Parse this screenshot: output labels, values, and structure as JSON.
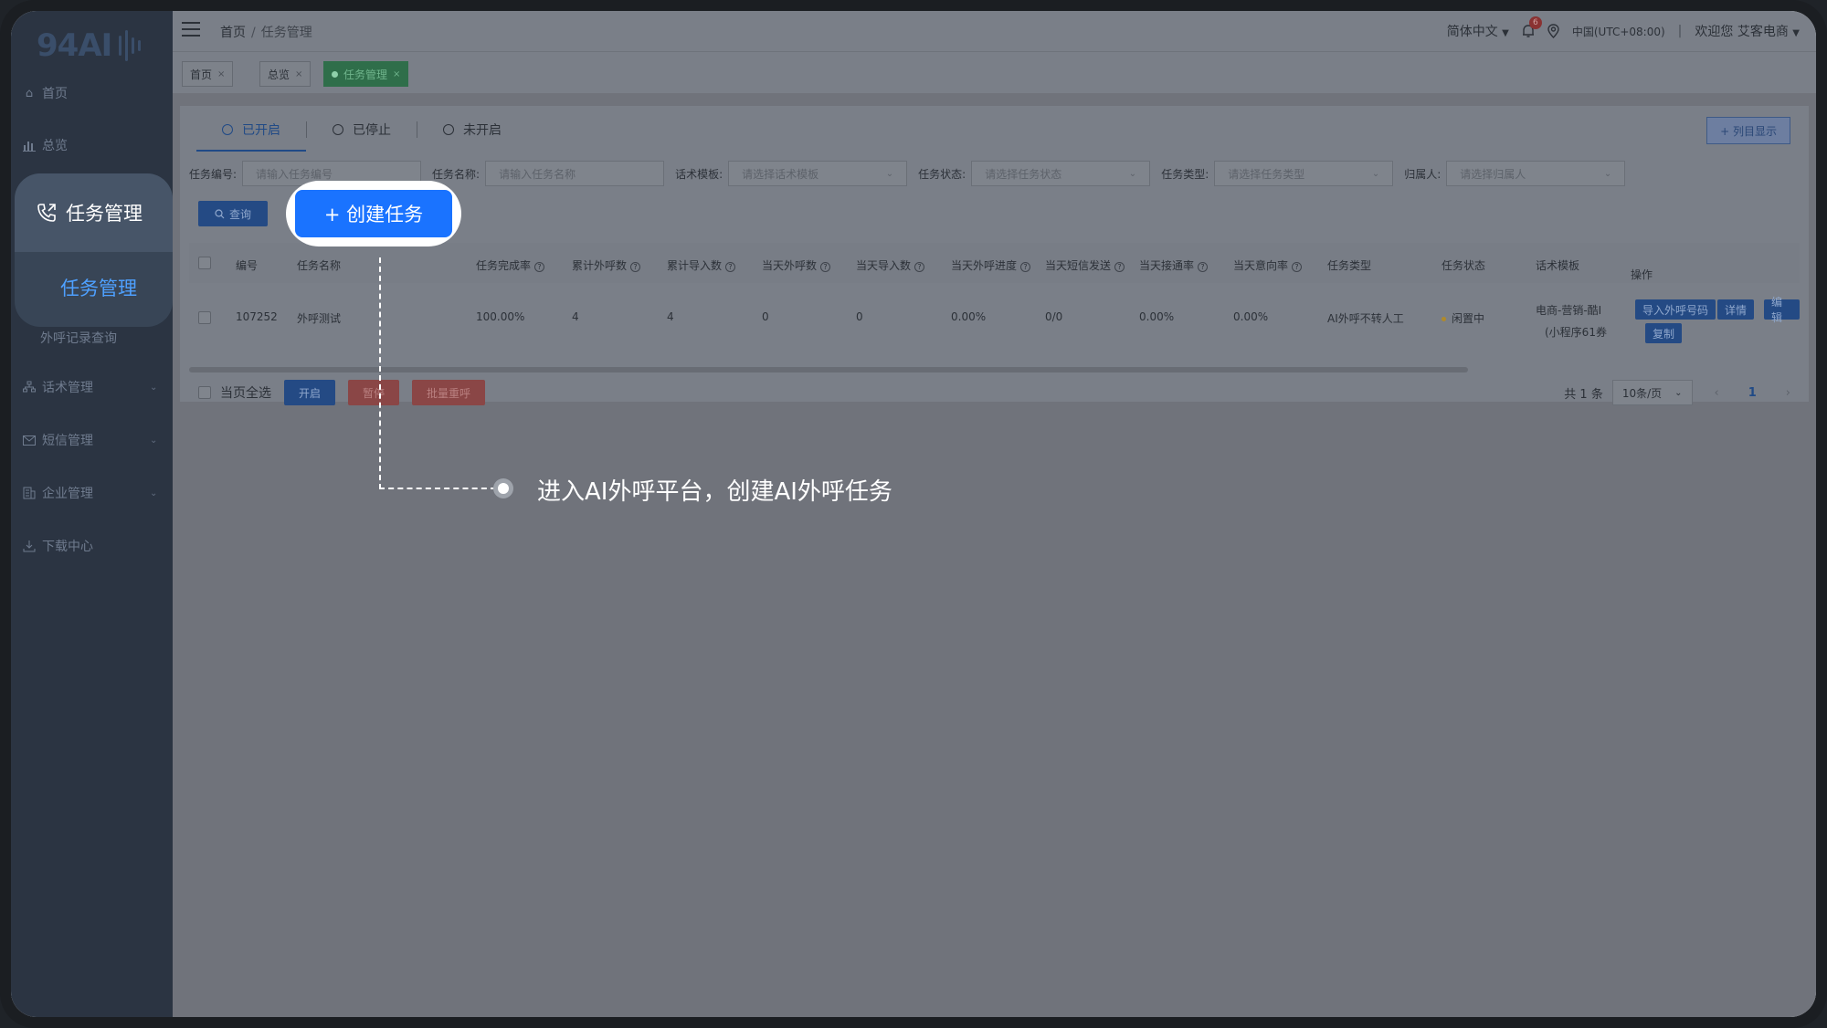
{
  "logo": {
    "text": "94AI"
  },
  "sidebar": {
    "items": [
      {
        "label": "首页",
        "icon": "home-icon"
      },
      {
        "label": "总览",
        "icon": "chart-icon"
      },
      {
        "label": "任务管理",
        "icon": "phone-icon"
      },
      {
        "label": "任务管理",
        "sub": true
      },
      {
        "label": "外呼记录查询",
        "sub": true
      },
      {
        "label": "话术管理",
        "icon": "org-icon",
        "expandable": true
      },
      {
        "label": "短信管理",
        "icon": "mail-icon",
        "expandable": true
      },
      {
        "label": "企业管理",
        "icon": "building-icon",
        "expandable": true
      },
      {
        "label": "下载中心",
        "icon": "download-icon"
      }
    ]
  },
  "header": {
    "breadcrumb": [
      "首页",
      "任务管理"
    ],
    "language": "简体中文",
    "notification_count": "6",
    "timezone": "中国(UTC+08:00)",
    "welcome": "欢迎您 艾客电商"
  },
  "page_tabs": [
    "首页",
    "总览",
    "任务管理"
  ],
  "status_tabs": [
    "已开启",
    "已停止",
    "未开启"
  ],
  "column_button": "+ 列目显示",
  "filters": [
    {
      "label": "任务编号:",
      "placeholder": "请输入任务编号"
    },
    {
      "label": "任务名称:",
      "placeholder": "请输入任务名称"
    },
    {
      "label": "话术模板:",
      "placeholder": "请选择话术模板"
    },
    {
      "label": "任务状态:",
      "placeholder": "请选择任务状态"
    },
    {
      "label": "任务类型:",
      "placeholder": "请选择任务类型"
    },
    {
      "label": "归属人:",
      "placeholder": "请选择归属人"
    }
  ],
  "query_button": "查询",
  "create_button": "+ 创建任务",
  "table": {
    "headers": [
      "编号",
      "任务名称",
      "任务完成率",
      "累计外呼数",
      "累计导入数",
      "当天外呼数",
      "当天导入数",
      "当天外呼进度",
      "当天短信发送",
      "当天接通率",
      "当天意向率",
      "任务类型",
      "任务状态",
      "话术模板",
      "操作"
    ],
    "row": {
      "id": "107252",
      "name": "外呼测试",
      "completion": "100.00%",
      "total_calls": "4",
      "total_imports": "4",
      "today_calls": "0",
      "today_imports": "0",
      "today_progress": "0.00%",
      "today_sms": "0/0",
      "connect_rate": "0.00%",
      "intent_rate": "0.00%",
      "type": "AI外呼不转人工",
      "status": "闲置中",
      "template_line1": "电商-营销-酷I",
      "template_line2": "(小程序61券",
      "ops": [
        "导入外呼号码",
        "详情",
        "编辑",
        "复制"
      ]
    }
  },
  "bottom": {
    "select_all": "当页全选",
    "open": "开启",
    "pause": "暂停",
    "batch_redial": "批量重呼"
  },
  "pager": {
    "total": "共 1 条",
    "page_size": "10条/页",
    "current": "1"
  },
  "callout": "进入AI外呼平台，创建AI外呼任务"
}
